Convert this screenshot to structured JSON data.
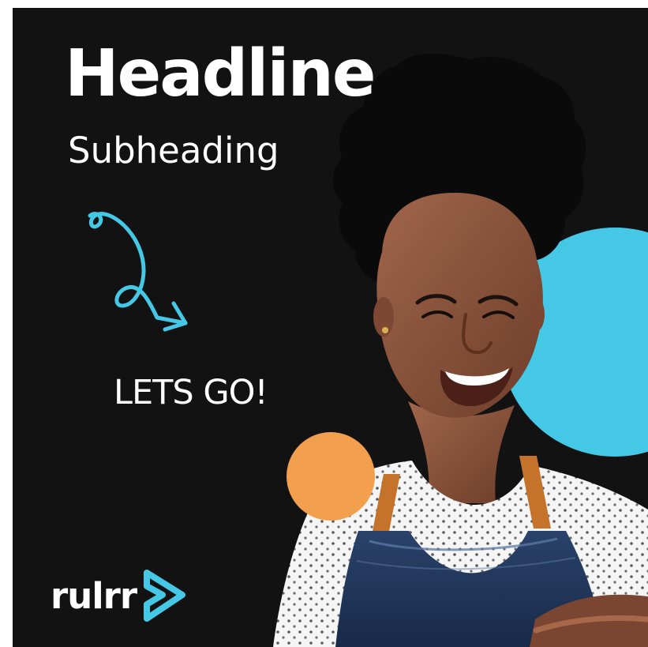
{
  "ad": {
    "headline": "Headline",
    "subheading": "Subheading",
    "cta": "LETS GO!",
    "brand": "rulrr"
  },
  "colors": {
    "background": "#121212",
    "text": "#ffffff",
    "accent_blue": "#45c8e6",
    "accent_orange": "#f3a04e",
    "apron": "#1f3458",
    "shirt": "#f3f3f3",
    "skin": "#9a5b3f"
  },
  "icons": {
    "arrow": "curly-arrow-icon",
    "logo": "rulrr-logo-icon"
  }
}
